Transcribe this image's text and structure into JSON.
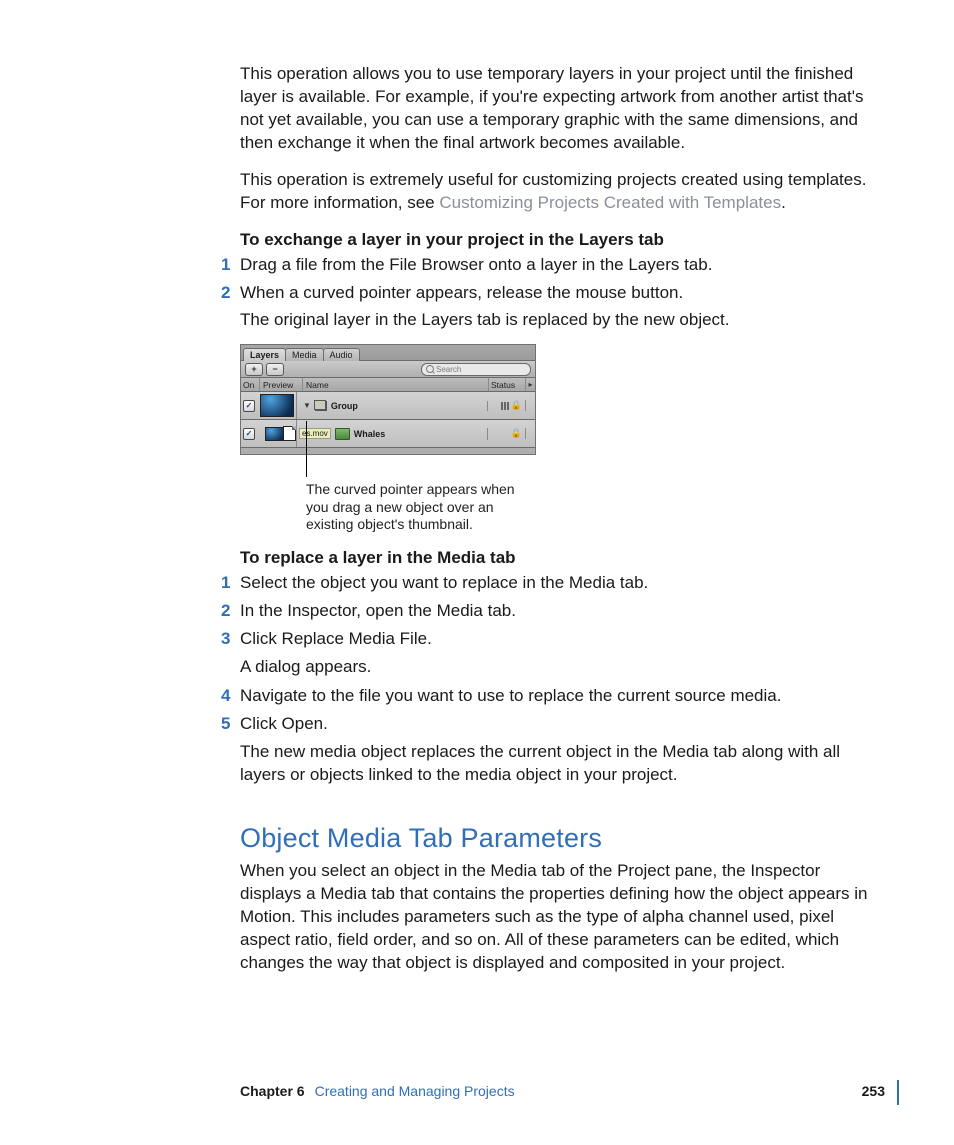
{
  "paragraphs": {
    "p1": "This operation allows you to use temporary layers in your project until the finished layer is available. For example, if you're expecting artwork from another artist that's not yet available, you can use a temporary graphic with the same dimensions, and then exchange it when the final artwork becomes available.",
    "p2a": "This operation is extremely useful for customizing projects created using templates. For more information, see ",
    "p2_link": "Customizing Projects Created with Templates",
    "p2b": ".",
    "task1_title": "To exchange a layer in your project in the Layers tab",
    "task1_step1": "Drag a file from the File Browser onto a layer in the Layers tab.",
    "task1_step2": "When a curved pointer appears, release the mouse button.",
    "task1_body": "The original layer in the Layers tab is replaced by the new object.",
    "callout": "The curved pointer appears when you drag a new object over an existing object's thumbnail.",
    "task2_title": "To replace a layer in the Media tab",
    "task2_step1": "Select the object you want to replace in the Media tab.",
    "task2_step2": "In the Inspector, open the Media tab.",
    "task2_step3": "Click Replace Media File.",
    "task2_body3": "A dialog appears.",
    "task2_step4": "Navigate to the file you want to use to replace the current source media.",
    "task2_step5": "Click Open.",
    "task2_body5": "The new media object replaces the current object in the Media tab along with all layers or objects linked to the media object in your project."
  },
  "section": {
    "heading": "Object Media Tab Parameters",
    "body": "When you select an object in the Media tab of the Project pane, the Inspector displays a Media tab that contains the properties defining how the object appears in Motion. This includes parameters such as the type of alpha channel used, pixel aspect ratio, field order, and so on. All of these parameters can be edited, which changes the way that object is displayed and composited in your project."
  },
  "screenshot": {
    "tabs": {
      "layers": "Layers",
      "media": "Media",
      "audio": "Audio"
    },
    "toolbar": {
      "plus": "+",
      "minus": "−"
    },
    "search_placeholder": "Search",
    "headers": {
      "on": "On",
      "preview": "Preview",
      "name": "Name",
      "status": "Status"
    },
    "rows": {
      "group": "Group",
      "drag_label": "es.mov",
      "whales": "Whales"
    }
  },
  "footer": {
    "chapter": "Chapter 6",
    "title": "Creating and Managing Projects",
    "page": "253"
  },
  "nums": {
    "n1": "1",
    "n2": "2",
    "n3": "3",
    "n4": "4",
    "n5": "5"
  }
}
